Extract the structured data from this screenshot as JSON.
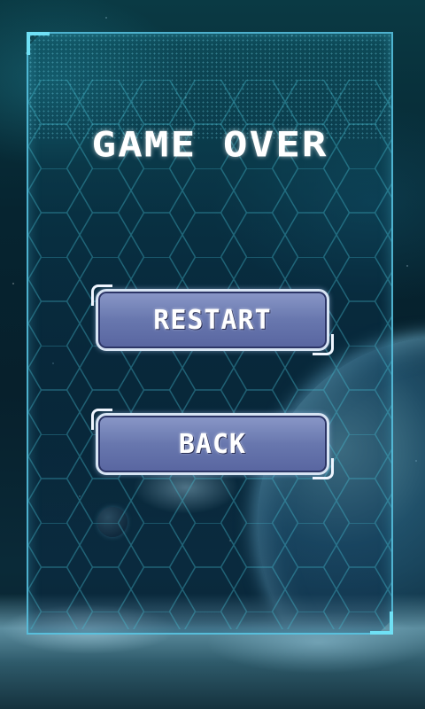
{
  "screen": {
    "title": "GAME OVER"
  },
  "buttons": {
    "restart_label": "RESTART",
    "back_label": "BACK"
  },
  "colors": {
    "frame_accent": "#6fe0f5",
    "button_fill": "#6877ae",
    "button_border": "#d7e4f3",
    "text": "#ffffff"
  }
}
